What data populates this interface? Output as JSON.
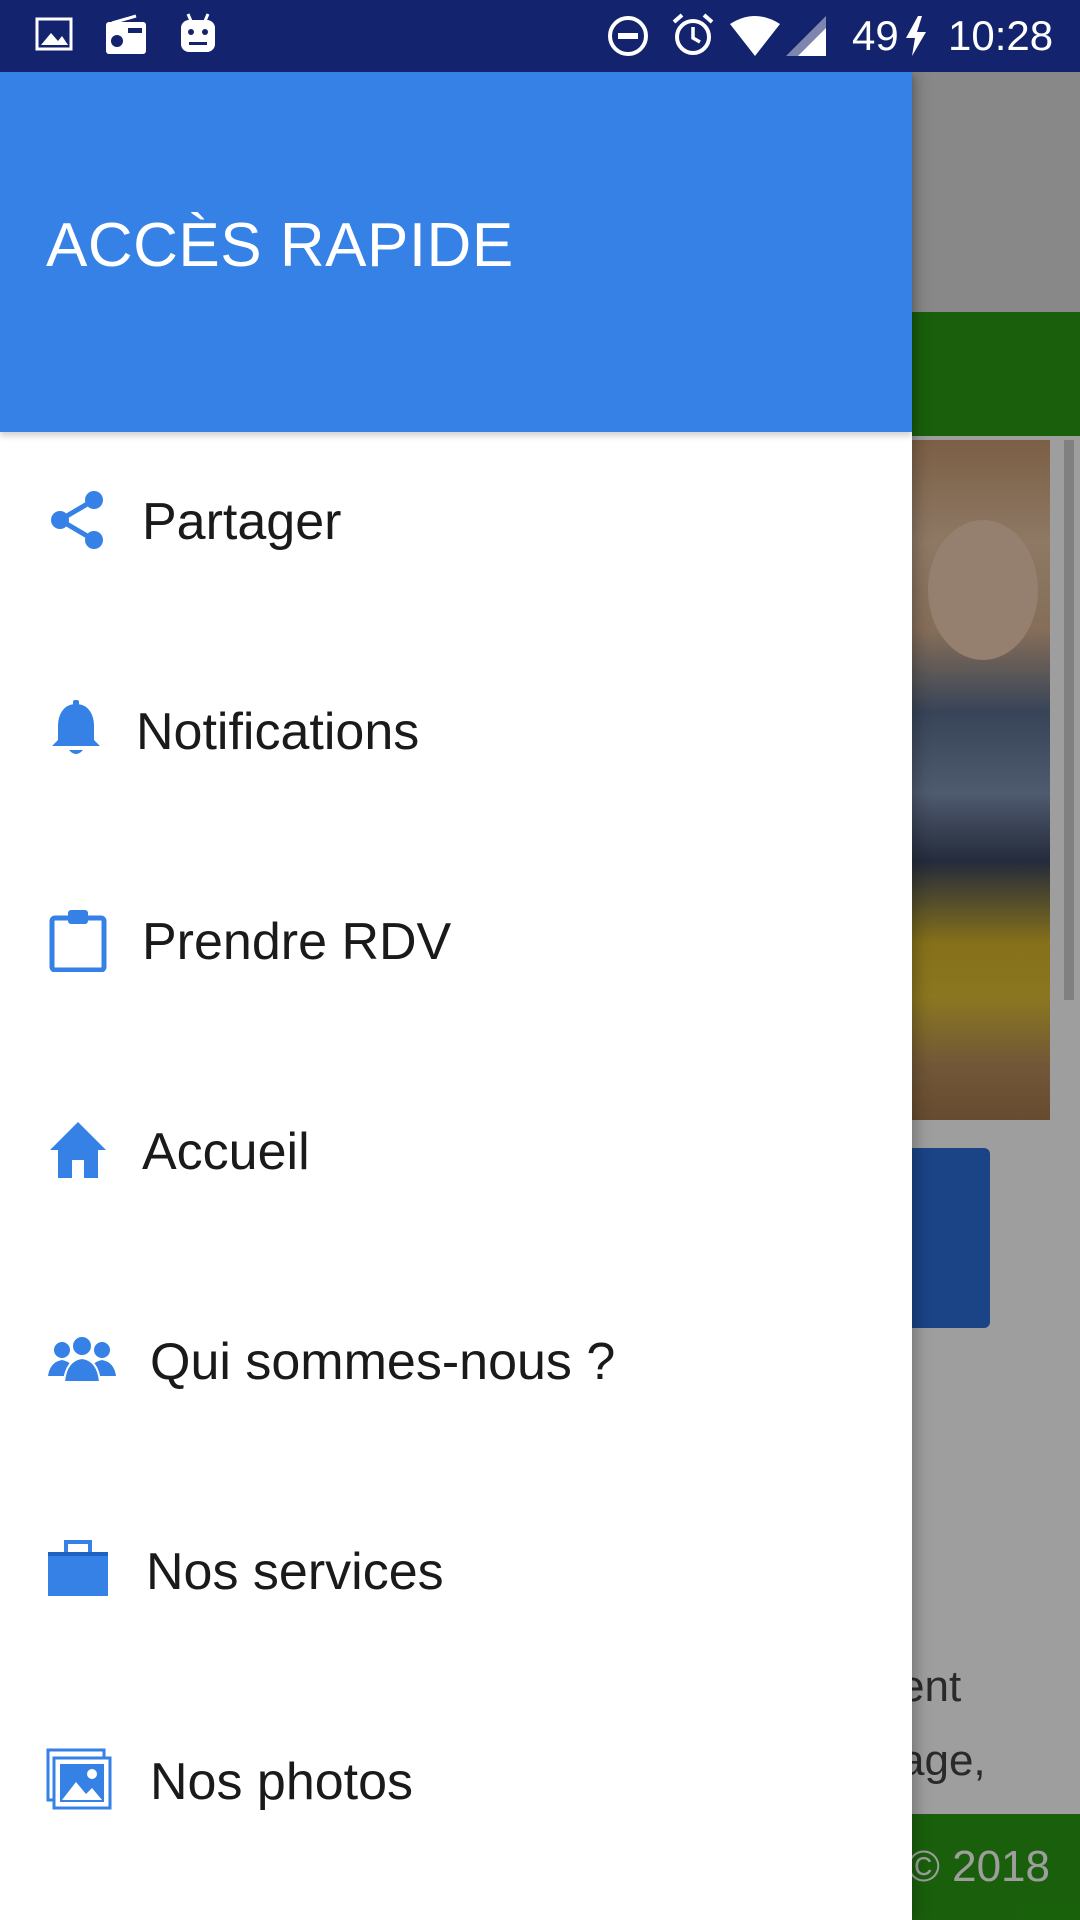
{
  "status_bar": {
    "battery": "49",
    "time": "10:28",
    "icons": [
      "image-icon",
      "radio-icon",
      "android-icon",
      "do-not-disturb-icon",
      "alarm-icon",
      "wifi-icon",
      "signal-icon",
      "charging-icon"
    ]
  },
  "drawer": {
    "title": "ACCÈS RAPIDE",
    "accent_color": "#3581e5",
    "items": [
      {
        "label": "Partager",
        "icon": "share-icon"
      },
      {
        "label": "Notifications",
        "icon": "bell-icon"
      },
      {
        "label": "Prendre RDV",
        "icon": "clipboard-icon"
      },
      {
        "label": "Accueil",
        "icon": "home-icon"
      },
      {
        "label": "Qui sommes-nous ?",
        "icon": "group-icon"
      },
      {
        "label": "Nos services",
        "icon": "briefcase-icon"
      },
      {
        "label": "Nos photos",
        "icon": "photos-icon"
      }
    ]
  },
  "background": {
    "text_line_1": "ent",
    "text_line_2": "age,",
    "footer": "© 2018"
  }
}
